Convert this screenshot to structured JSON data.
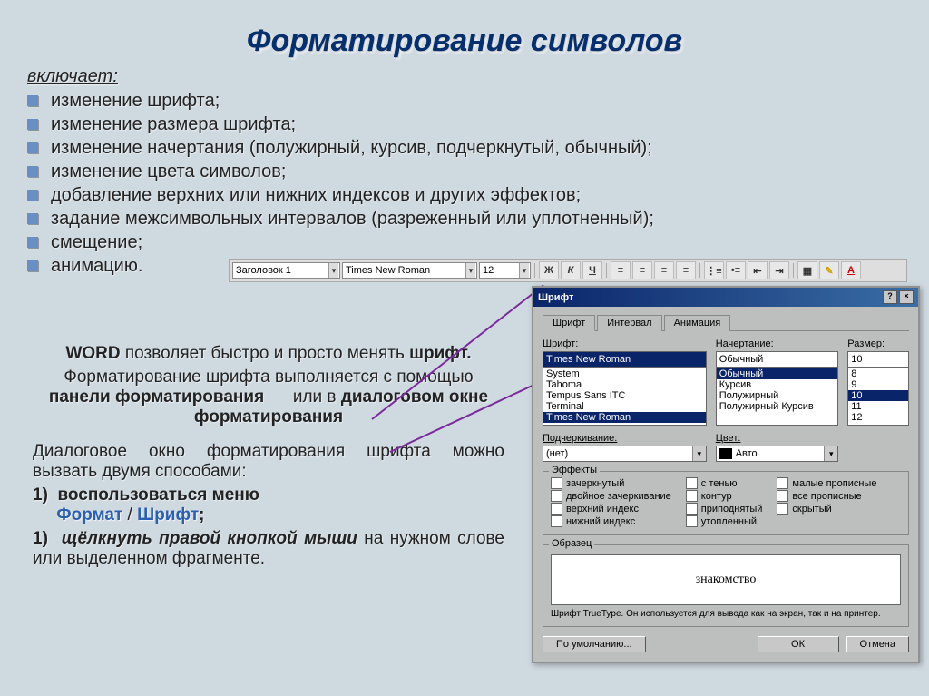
{
  "title": "Форматирование символов",
  "intro": "включает:",
  "bullets": [
    "изменение шрифта;",
    "изменение размера шрифта;",
    "изменение начертания (полужирный, курсив, подчеркнутый, обычный);",
    "изменение цвета символов;",
    "добавление верхних или нижних индексов и других эффектов;",
    "задание межсимвольных интервалов (разреженный или уплотненный);",
    "смещение;",
    "анимацию."
  ],
  "toolbar": {
    "style": "Заголовок 1",
    "font": "Times New Roman",
    "size": "12",
    "bold": "Ж",
    "italic": "К",
    "underline": "Ч"
  },
  "body": {
    "p1a": "WORD",
    "p1b": " позволяет быстро и просто менять ",
    "p1c": "шрифт.",
    "p2a": "Форматирование шрифта выполняется с помощью ",
    "p2b": "панели форматирования",
    "p2_or": " или в ",
    "p2c": "диалоговом окне форматирования",
    "p3": "Диалоговое окно форматирования шрифта можно вызвать двумя способами:",
    "li1_num": "1)",
    "li1": "воспользоваться меню",
    "li1_menu1": "Формат",
    "li1_sep": " / ",
    "li1_menu2": "Шрифт",
    "li1_end": ";",
    "li2_num": "1)",
    "li2a": "щёлкнуть правой кнопкой мыши",
    "li2b": " на нужном слове или выделенном фрагменте."
  },
  "dialog": {
    "title": "Шрифт",
    "tabs": [
      "Шрифт",
      "Интервал",
      "Анимация"
    ],
    "font_label": "Шрифт:",
    "font_value": "Times New Roman",
    "font_list": [
      "System",
      "Tahoma",
      "Tempus Sans ITC",
      "Terminal",
      "Times New Roman"
    ],
    "variant_label": "Начертание:",
    "variant_value": "Обычный",
    "variant_list": [
      "Обычный",
      "Курсив",
      "Полужирный",
      "Полужирный Курсив"
    ],
    "size_label": "Размер:",
    "size_value": "10",
    "size_list": [
      "8",
      "9",
      "10",
      "11",
      "12"
    ],
    "underline_label": "Подчеркивание:",
    "underline_value": "(нет)",
    "color_label": "Цвет:",
    "color_value": "Авто",
    "effects_label": "Эффекты",
    "effects_col1": [
      "зачеркнутый",
      "двойное зачеркивание",
      "верхний индекс",
      "нижний индекс"
    ],
    "effects_col2": [
      "с тенью",
      "контур",
      "приподнятый",
      "утопленный"
    ],
    "effects_col3": [
      "малые прописные",
      "все прописные",
      "скрытый"
    ],
    "sample_label": "Образец",
    "sample_text": "знакомство",
    "hint": "Шрифт TrueType. Он используется для вывода как на экран, так и на принтер.",
    "btn_default": "По умолчанию...",
    "btn_ok": "ОК",
    "btn_cancel": "Отмена"
  }
}
